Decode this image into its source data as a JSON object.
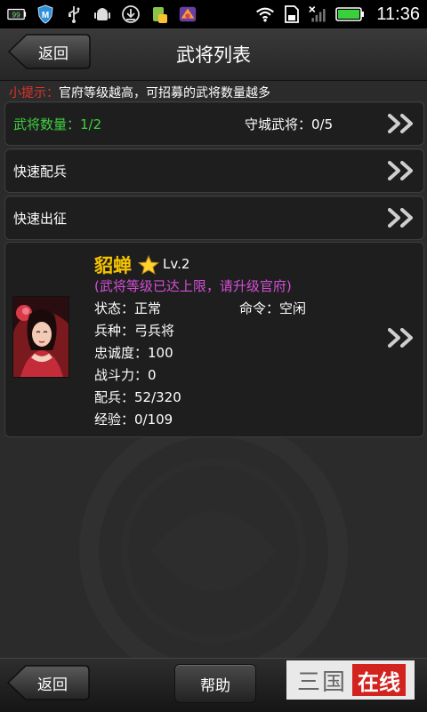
{
  "status_bar": {
    "battery_small": "99",
    "time": "11:36",
    "icons": [
      "battery-small-icon",
      "shield-m-icon",
      "usb-icon",
      "android-debug-icon",
      "download-icon",
      "app-icon",
      "game-app-icon",
      "wifi-icon",
      "sd-card-icon",
      "no-signal-icon",
      "battery-icon"
    ]
  },
  "header": {
    "back_label": "返回",
    "title": "武将列表"
  },
  "tip": {
    "label": "小提示：",
    "text": "官府等级越高，可招募的武将数量越多"
  },
  "rows": {
    "general_count_label": "武将数量：1/2",
    "defense_label": "守城武将：0/5",
    "quick_troops_label": "快速配兵",
    "quick_march_label": "快速出征"
  },
  "general": {
    "name": "貂蝉",
    "level": "Lv.2",
    "warning": "(武将等级已达上限，请升级官府)",
    "state": "状态：正常",
    "command": "命令：空闲",
    "troop_type": "兵种：弓兵将",
    "loyalty": "忠诚度：100",
    "combat_power": "战斗力：0",
    "troops": "配兵：52/320",
    "experience": "经验：0/109"
  },
  "bottom_bar": {
    "back_label": "返回",
    "help_label": "帮助",
    "logo_left": "三国",
    "logo_right": "在线"
  },
  "colors": {
    "tip_label": "#e0342a",
    "general_count": "#3fcf3f",
    "general_name": "#f5c400",
    "warning": "#d24fd6",
    "logo_red": "#d2231f"
  }
}
